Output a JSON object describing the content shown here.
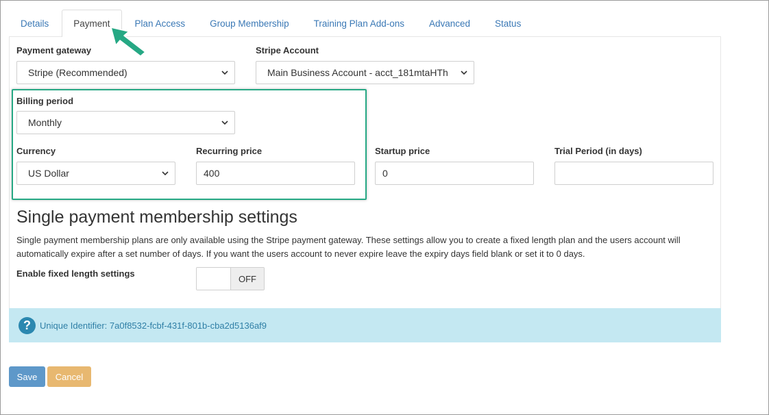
{
  "tabs": [
    {
      "label": "Details"
    },
    {
      "label": "Payment"
    },
    {
      "label": "Plan Access"
    },
    {
      "label": "Group Membership"
    },
    {
      "label": "Training Plan Add-ons"
    },
    {
      "label": "Advanced"
    },
    {
      "label": "Status"
    }
  ],
  "form": {
    "payment_gateway": {
      "label": "Payment gateway",
      "value": "Stripe (Recommended)"
    },
    "stripe_account": {
      "label": "Stripe Account",
      "value": "Main Business Account - acct_181mtaHTh"
    },
    "billing_period": {
      "label": "Billing period",
      "value": "Monthly"
    },
    "currency": {
      "label": "Currency",
      "value": "US Dollar"
    },
    "recurring_price": {
      "label": "Recurring price",
      "value": "400"
    },
    "startup_price": {
      "label": "Startup price",
      "value": "0"
    },
    "trial_period": {
      "label": "Trial Period (in days)",
      "value": ""
    }
  },
  "single_payment": {
    "title": "Single payment membership settings",
    "description": "Single payment membership plans are only available using the Stripe payment gateway. These settings allow you to create a fixed length plan and the users account will automatically expire after a set number of days. If you want the users account to never expire leave the expiry days field blank or set it to 0 days.",
    "fixed_length_label": "Enable fixed length settings",
    "toggle_state": "OFF"
  },
  "info": {
    "icon": "question-circle-icon",
    "unique_identifier": "Unique Identifier: 7a0f8532-fcbf-431f-801b-cba2d5136af9"
  },
  "actions": {
    "save_label": "Save",
    "cancel_label": "Cancel"
  },
  "colors": {
    "highlight": "#26a884",
    "link": "#3a78b5",
    "info_bg": "#c4e8f2",
    "save": "#5e98c9",
    "cancel": "#e8b870"
  }
}
